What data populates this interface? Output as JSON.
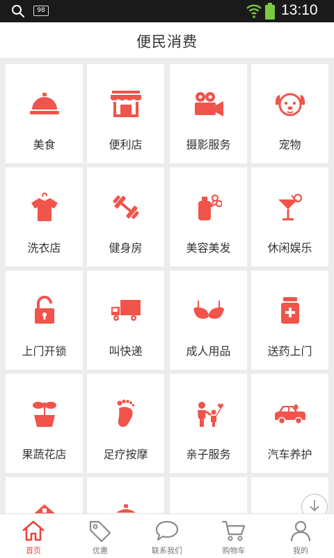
{
  "status_bar": {
    "badge": "98",
    "time": "13:10"
  },
  "header": {
    "title": "便民消费"
  },
  "services": [
    {
      "label": "美食",
      "icon": "cloche-icon"
    },
    {
      "label": "便利店",
      "icon": "store-icon"
    },
    {
      "label": "摄影服务",
      "icon": "video-camera-icon"
    },
    {
      "label": "宠物",
      "icon": "dog-icon"
    },
    {
      "label": "洗衣店",
      "icon": "shirt-hanger-icon"
    },
    {
      "label": "健身房",
      "icon": "dumbbell-icon"
    },
    {
      "label": "美容美发",
      "icon": "scissors-bottle-icon"
    },
    {
      "label": "休闲娱乐",
      "icon": "cocktail-icon"
    },
    {
      "label": "上门开锁",
      "icon": "padlock-icon"
    },
    {
      "label": "叫快递",
      "icon": "truck-icon"
    },
    {
      "label": "成人用品",
      "icon": "bra-icon"
    },
    {
      "label": "送药上门",
      "icon": "medicine-bottle-icon"
    },
    {
      "label": "果蔬花店",
      "icon": "flower-pot-icon"
    },
    {
      "label": "足疗按摩",
      "icon": "footprint-icon"
    },
    {
      "label": "亲子服务",
      "icon": "parent-child-icon"
    },
    {
      "label": "汽车养护",
      "icon": "car-icon"
    },
    {
      "label": "",
      "icon": "partial-sign-icon"
    },
    {
      "label": "",
      "icon": "partial-pot-icon"
    },
    {
      "label": "",
      "icon": ""
    },
    {
      "label": "",
      "icon": ""
    }
  ],
  "tabs": [
    {
      "label": "首页",
      "icon": "home-icon",
      "active": true
    },
    {
      "label": "优惠",
      "icon": "tag-icon",
      "active": false
    },
    {
      "label": "联系我们",
      "icon": "chat-bubble-icon",
      "active": false
    },
    {
      "label": "购物车",
      "icon": "shopping-cart-icon",
      "active": false
    },
    {
      "label": "我的",
      "icon": "user-icon",
      "active": false
    }
  ],
  "colors": {
    "accent": "#f0544a",
    "tab_active": "#e8443a",
    "tab_inactive": "#777777"
  }
}
